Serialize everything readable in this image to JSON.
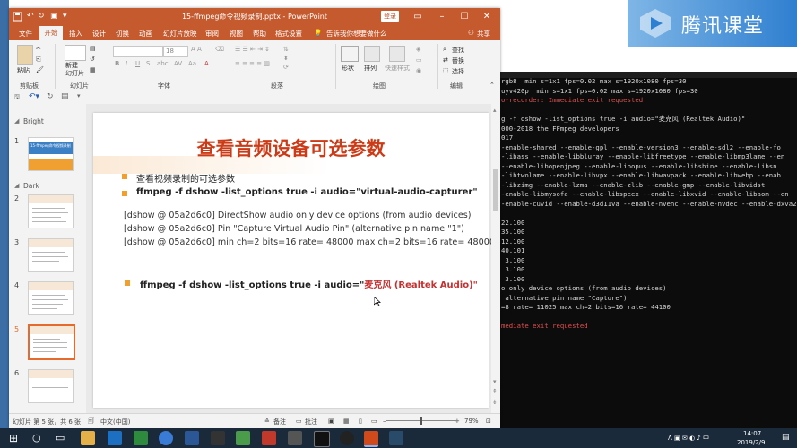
{
  "desktop": {
    "brand_text": "腾讯课堂"
  },
  "terminal": {
    "lines": [
      {
        "text": "rgb8  min s=1x1 fps=0.02 max s=1920x1080 fps=30",
        "color": "normal"
      },
      {
        "text": "uyv420p  min s=1x1 fps=0.02 max s=1920x1080 fps=30",
        "color": "normal"
      },
      {
        "text": "o-recorder: Immediate exit requested",
        "color": "red"
      },
      {
        "text": "",
        "color": "normal"
      },
      {
        "text": "g -f dshow -list_options true -i audio=\"麦克风 (Realtek Audio)\"",
        "color": "normal"
      },
      {
        "text": "000-2018 the FFmpeg developers",
        "color": "normal"
      },
      {
        "text": "017",
        "color": "normal"
      },
      {
        "text": "-enable-shared --enable-gpl --enable-version3 --enable-sdl2 --enable-fo",
        "color": "normal"
      },
      {
        "text": "-libass --enable-libbluray --enable-libfreetype --enable-libmp3lame --en",
        "color": "normal"
      },
      {
        "text": "--enable-libopenjpeg --enable-libopus --enable-libshine --enable-libsn",
        "color": "normal"
      },
      {
        "text": "-libtwolame --enable-libvpx --enable-libwavpack --enable-libwebp --enab",
        "color": "normal"
      },
      {
        "text": "-libzimg --enable-lzma --enable-zlib --enable-gmp --enable-libvidst",
        "color": "normal"
      },
      {
        "text": "-enable-libmysofa --enable-libspeex --enable-libxvid --enable-libaom --en",
        "color": "normal"
      },
      {
        "text": "-enable-cuvid --enable-d3d11va --enable-nvenc --enable-nvdec --enable-dxva2",
        "color": "normal"
      },
      {
        "text": "",
        "color": "normal"
      },
      {
        "text": "22.100",
        "color": "normal"
      },
      {
        "text": "35.100",
        "color": "normal"
      },
      {
        "text": "12.100",
        "color": "normal"
      },
      {
        "text": "40.101",
        "color": "normal"
      },
      {
        "text": " 3.100",
        "color": "normal"
      },
      {
        "text": " 3.100",
        "color": "normal"
      },
      {
        "text": " 3.100",
        "color": "normal"
      },
      {
        "text": "o only device options (from audio devices)",
        "color": "normal"
      },
      {
        "text": " alternative pin name \"Capture\")",
        "color": "normal"
      },
      {
        "text": "=8 rate= 11025 max ch=2 bits=16 rate= 44100",
        "color": "normal"
      },
      {
        "text": "",
        "color": "normal"
      },
      {
        "text": "mediate exit requested",
        "color": "red"
      }
    ]
  },
  "ppt": {
    "title": "15-ffmpeg命令视频录制.pptx  -  PowerPoint",
    "login_label": "登录",
    "tabs": [
      "文件",
      "开始",
      "插入",
      "设计",
      "切换",
      "动画",
      "幻灯片放映",
      "审阅",
      "视图",
      "帮助",
      "格式设置"
    ],
    "active_tab": "开始",
    "tell_me": "告诉我你想要做什么",
    "share_label": "共享",
    "ribbon": {
      "paste_label": "粘贴",
      "new_slide_label": "新建\n幻灯片",
      "font_name_placeholder": "",
      "font_size": "18",
      "shape_label": "形状",
      "arrange_label": "排列",
      "quick_style_label": "快速样式",
      "find_label": "查找",
      "replace_label": "替换",
      "select_label": "选择",
      "groups": [
        "剪贴板",
        "幻灯片",
        "字体",
        "段落",
        "绘图",
        "编辑"
      ]
    },
    "thumbnails": {
      "sections": [
        "Bright",
        "Dark"
      ],
      "items": [
        {
          "num": "1",
          "title": "15-ffmpeg命令视频录制"
        },
        {
          "num": "2",
          "title": ""
        },
        {
          "num": "3",
          "title": ""
        },
        {
          "num": "4",
          "title": ""
        },
        {
          "num": "5",
          "title": ""
        },
        {
          "num": "6",
          "title": ""
        }
      ],
      "selected": "5"
    },
    "slide": {
      "title": "查看音频设备可选参数",
      "bullet1": "查看视频录制的可选参数",
      "bullet2": "ffmpeg -f dshow -list_options true -i audio=\"virtual-audio-capturer\"",
      "output_lines": [
        "[dshow @ 05a2d6c0] DirectShow audio only device options (from audio devices)",
        "[dshow @ 05a2d6c0]  Pin \"Capture Virtual Audio Pin\" (alternative pin name \"1\")",
        "[dshow @ 05a2d6c0]   min ch=2 bits=16 rate= 48000 max ch=2 bits=16 rate= 48000"
      ],
      "bullet3_prefix": "ffmpeg -f dshow -list_options true -i audio=\"",
      "bullet3_highlight": "麦克风 (Realtek Audio)\""
    },
    "status": {
      "slide_info": "幻灯片 第 5 张，共 6 张",
      "language": "中文(中国)",
      "notes_label": "备注",
      "comments_label": "批注",
      "zoom": "79%",
      "zoom_fraction": 0.48
    }
  },
  "taskbar": {
    "time": "14:07",
    "date": "2019/2/9"
  }
}
